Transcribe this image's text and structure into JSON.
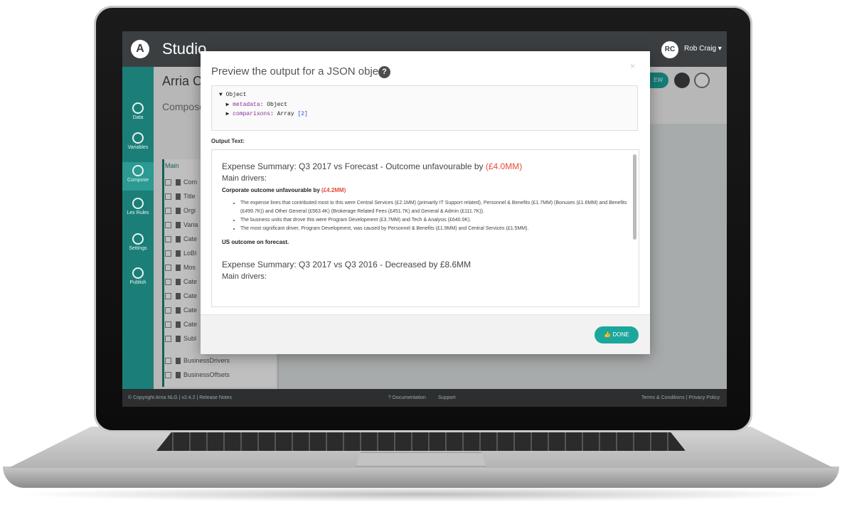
{
  "app": {
    "logo": "A",
    "title": "Studio"
  },
  "user": {
    "initials": "RC",
    "name": "Rob Craig ▾"
  },
  "header": {
    "project_title": "Arria Ca",
    "compose_label": "Compose",
    "preview_label": "EW"
  },
  "sidebar": {
    "items": [
      {
        "label": "Data",
        "icon": "data-icon"
      },
      {
        "label": "Variables",
        "icon": "variables-icon"
      },
      {
        "label": "Compose",
        "icon": "compose-icon"
      },
      {
        "label": "Lex Rules",
        "icon": "lex-rules-icon"
      },
      {
        "label": "Settings",
        "icon": "settings-icon"
      },
      {
        "label": "Publish",
        "icon": "publish-icon"
      }
    ]
  },
  "script_list": {
    "main_label": "Main",
    "rows": [
      "Com",
      "Title",
      "Orgi",
      "Varia",
      "Cate",
      "LoBI",
      "Mos",
      "Cate",
      "Cate",
      "Cate",
      "Cate",
      "Subl",
      "BusinessDrivers",
      "BusinessOffsets"
    ]
  },
  "modal": {
    "title": "Preview the output for a JSON object",
    "help": "?",
    "close": "×",
    "json_tree": {
      "root": "▼ Object",
      "line1_key": "metadata",
      "line1_val": ": Object",
      "line2_key": "comparisons",
      "line2_val": ": Array",
      "line2_count": "[2]"
    },
    "output_label": "Output Text:",
    "section1": {
      "heading": "Expense Summary: Q3 2017 vs Forecast - Outcome unfavourable by ",
      "heading_value": "(£4.0MM)",
      "drivers": "Main drivers:",
      "corporate": "Corporate outcome unfavourable by ",
      "corporate_value": "(£4.2MM)",
      "bullet1": "The expense lines that contributed most to this were Central Services (£2.1MM) (primarily IT Support related), Personnel & Benefits (£1.7MM) (Bonuses (£1.6MM) and Benefits (£499.7K)) and Other General (£563.4K) (Brokerage Related Fees (£451.7K) and General & Admin (£111.7K)).",
      "bullet2": "The business units that drove this were Program Development (£3.7MM) and Tech & Analysis (£640.0K).",
      "bullet3": "The most significant driver, Program Development, was caused by Personnel & Benefits (£1.9MM) and Central Services (£1.5MM).",
      "us_outcome": "US outcome on forecast."
    },
    "section2": {
      "heading": "Expense Summary: Q3 2017 vs Q3 2016 - Decreased by £8.6MM",
      "drivers": "Main drivers:"
    },
    "done_label": "DONE"
  },
  "footer": {
    "copyright": "© Copyright Arria NLG | v2.4.2 | Release Notes",
    "documentation": "? Documentation",
    "support": "Support",
    "terms": "Terms & Conditions | Privacy Policy"
  }
}
